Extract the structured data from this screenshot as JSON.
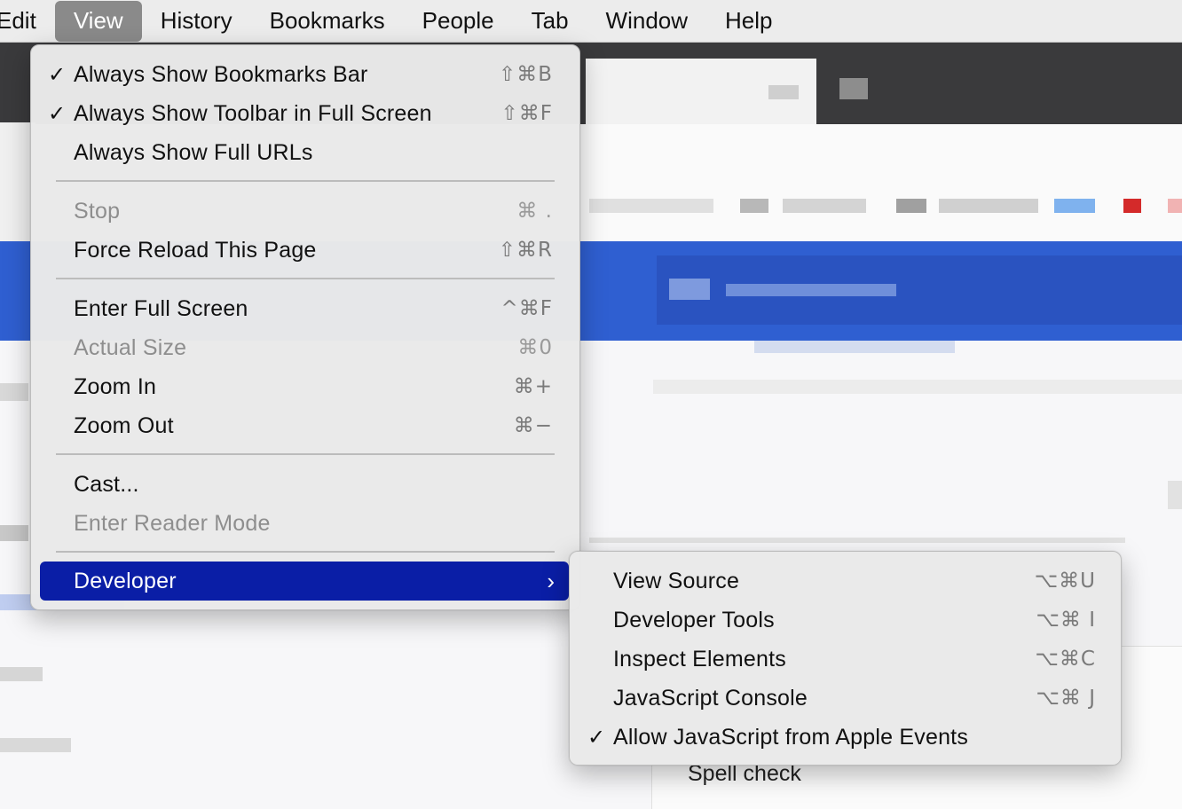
{
  "menubar": {
    "items": [
      "Edit",
      "View",
      "History",
      "Bookmarks",
      "People",
      "Tab",
      "Window",
      "Help"
    ],
    "active": "View"
  },
  "view_menu": {
    "items": [
      {
        "label": "Always Show Bookmarks Bar",
        "shortcut": "⇧⌘B",
        "checked": true,
        "enabled": true
      },
      {
        "label": "Always Show Toolbar in Full Screen",
        "shortcut": "⇧⌘F",
        "checked": true,
        "enabled": true
      },
      {
        "label": "Always Show Full URLs",
        "shortcut": "",
        "checked": false,
        "enabled": true
      },
      {
        "label": "Stop",
        "shortcut": "⌘ .",
        "checked": false,
        "enabled": false
      },
      {
        "label": "Force Reload This Page",
        "shortcut": "⇧⌘R",
        "checked": false,
        "enabled": true
      },
      {
        "label": "Enter Full Screen",
        "shortcut": "^⌘F",
        "checked": false,
        "enabled": true
      },
      {
        "label": "Actual Size",
        "shortcut": "⌘0",
        "checked": false,
        "enabled": false
      },
      {
        "label": "Zoom In",
        "shortcut": "⌘+",
        "checked": false,
        "enabled": true
      },
      {
        "label": "Zoom Out",
        "shortcut": "⌘−",
        "checked": false,
        "enabled": true
      },
      {
        "label": "Cast...",
        "shortcut": "",
        "checked": false,
        "enabled": true
      },
      {
        "label": "Enter Reader Mode",
        "shortcut": "",
        "checked": false,
        "enabled": false
      },
      {
        "label": "Developer",
        "submenu_arrow": "›",
        "highlighted": true
      }
    ],
    "check_glyph": "✓"
  },
  "developer_menu": {
    "items": [
      {
        "label": "View Source",
        "shortcut": "⌥⌘U",
        "checked": false
      },
      {
        "label": "Developer Tools",
        "shortcut": "⌥⌘ I",
        "checked": false
      },
      {
        "label": "Inspect Elements",
        "shortcut": "⌥⌘C",
        "checked": false
      },
      {
        "label": "JavaScript Console",
        "shortcut": "⌥⌘ J",
        "checked": false
      },
      {
        "label": "Allow JavaScript from Apple Events",
        "shortcut": "",
        "checked": true
      }
    ]
  },
  "background": {
    "spell_check_label": "Spell check",
    "accent_blue": "#2f5fd1",
    "highlight_blue": "#0a1ea6"
  }
}
